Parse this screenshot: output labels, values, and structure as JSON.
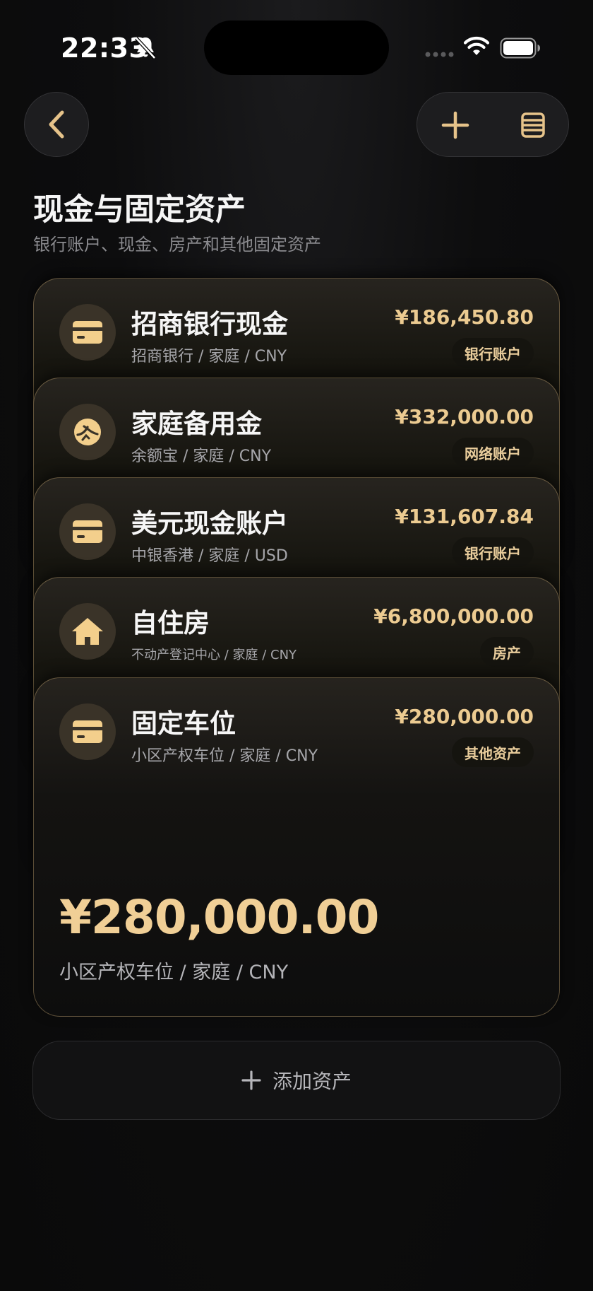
{
  "status": {
    "time": "22:33"
  },
  "header": {
    "title": "现金与固定资产",
    "subtitle": "银行账户、现金、房产和其他固定资产"
  },
  "colors": {
    "accent": "#eccb91",
    "background": "#0b0b0c",
    "card_border": "#d6b478"
  },
  "assets": [
    {
      "icon": "credit-card-icon",
      "name": "招商银行现金",
      "meta": "招商银行 / 家庭 / CNY",
      "amount": "¥186,450.80",
      "tag": "银行账户"
    },
    {
      "icon": "yuebao-icon",
      "name": "家庭备用金",
      "meta": "余额宝 / 家庭 / CNY",
      "amount": "¥332,000.00",
      "tag": "网络账户"
    },
    {
      "icon": "credit-card-icon",
      "name": "美元现金账户",
      "meta": "中银香港 / 家庭 / USD",
      "amount": "¥131,607.84",
      "tag": "银行账户"
    },
    {
      "icon": "house-icon",
      "name": "自住房",
      "meta": "不动产登记中心 / 家庭 / CNY",
      "amount": "¥6,800,000.00",
      "tag": "房产"
    },
    {
      "icon": "credit-card-icon",
      "name": "固定车位",
      "meta": "小区产权车位 / 家庭 / CNY",
      "amount": "¥280,000.00",
      "tag": "其他资产",
      "big_amount": "¥280,000.00",
      "big_meta": "小区产权车位 / 家庭 / CNY"
    }
  ],
  "add_button": {
    "label": "添加资产"
  }
}
